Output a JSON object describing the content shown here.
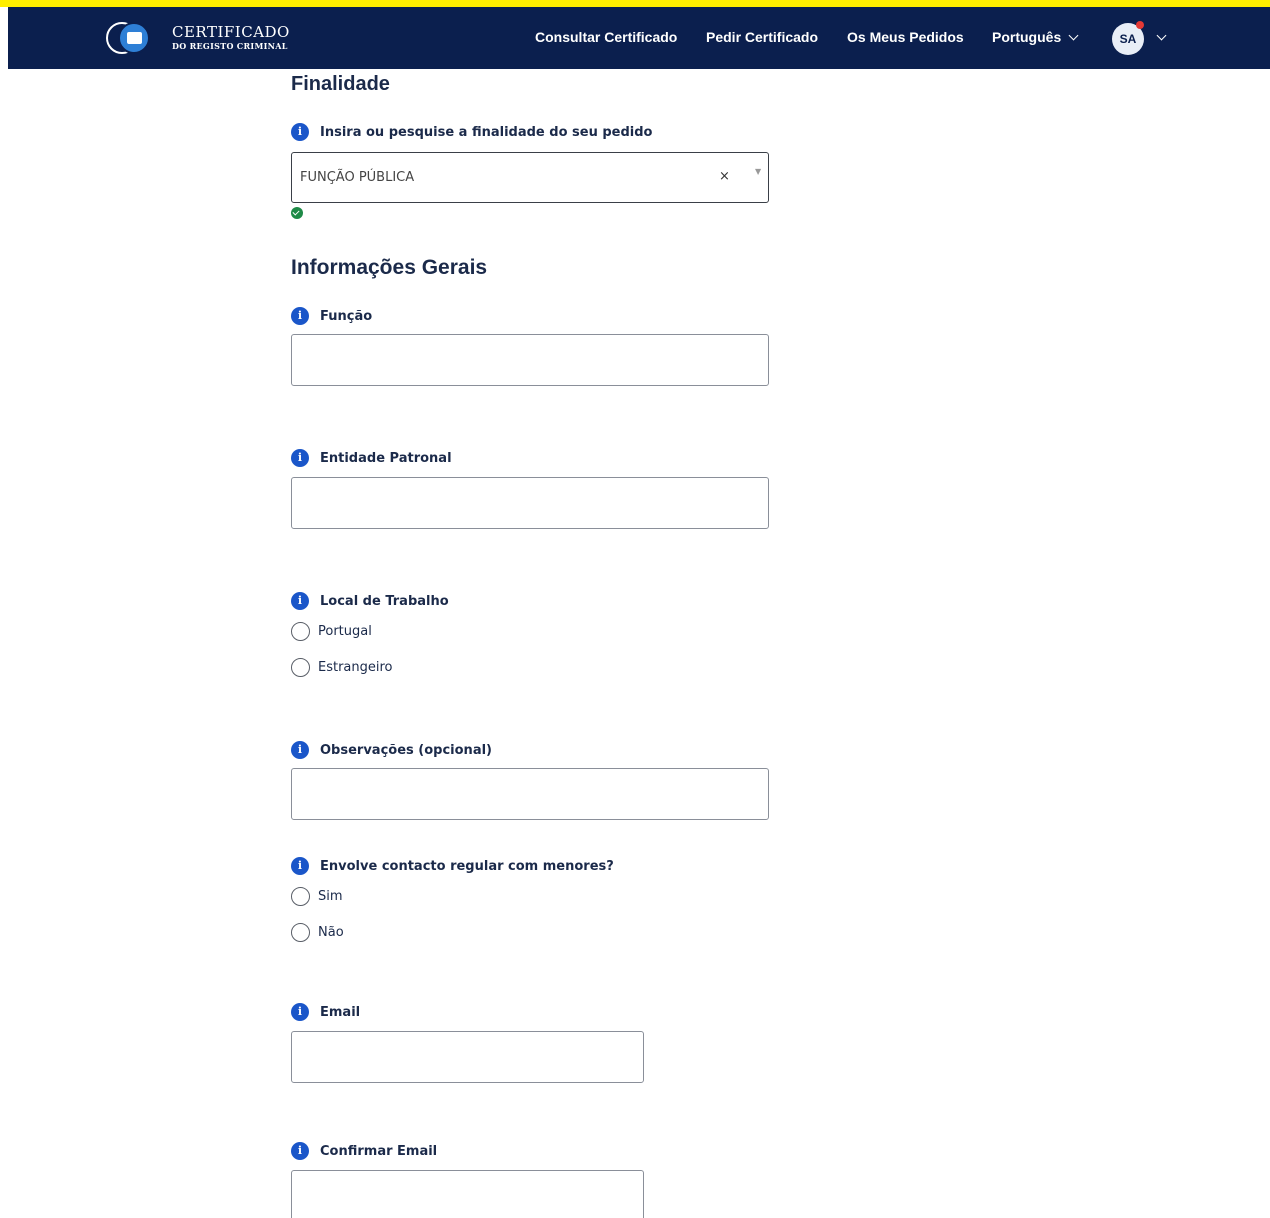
{
  "header": {
    "logo_line1": "CERTIFICADO",
    "logo_line2": "DO REGISTO CRIMINAL",
    "nav": [
      "Consultar Certificado",
      "Pedir Certificado",
      "Os Meus Pedidos"
    ],
    "language": "Português",
    "avatar_initials": "SA"
  },
  "finalidade": {
    "title": "Finalidade",
    "label": "Insira ou pesquise a finalidade do seu pedido",
    "selected_value": "FUNÇÃO PÚBLICA",
    "clear_symbol": "×",
    "arrow_symbol": "▼"
  },
  "informacoes": {
    "title": "Informações Gerais",
    "funcao_label": "Função",
    "entidade_label": "Entidade Patronal",
    "local_label": "Local de Trabalho",
    "local_options": [
      "Portugal",
      "Estrangeiro"
    ],
    "observacoes_label": "Observações (opcional)",
    "menores_label": "Envolve contacto regular com menores?",
    "menores_options": [
      "Sim",
      "Não"
    ],
    "email_label": "Email",
    "confirm_email_label": "Confirmar Email"
  },
  "info_icon_glyph": "i",
  "colors": {
    "navbar": "#0b1f4e",
    "accent": "#1a56c9",
    "valid": "#1e8a47",
    "top_banner": "#ffee00"
  }
}
